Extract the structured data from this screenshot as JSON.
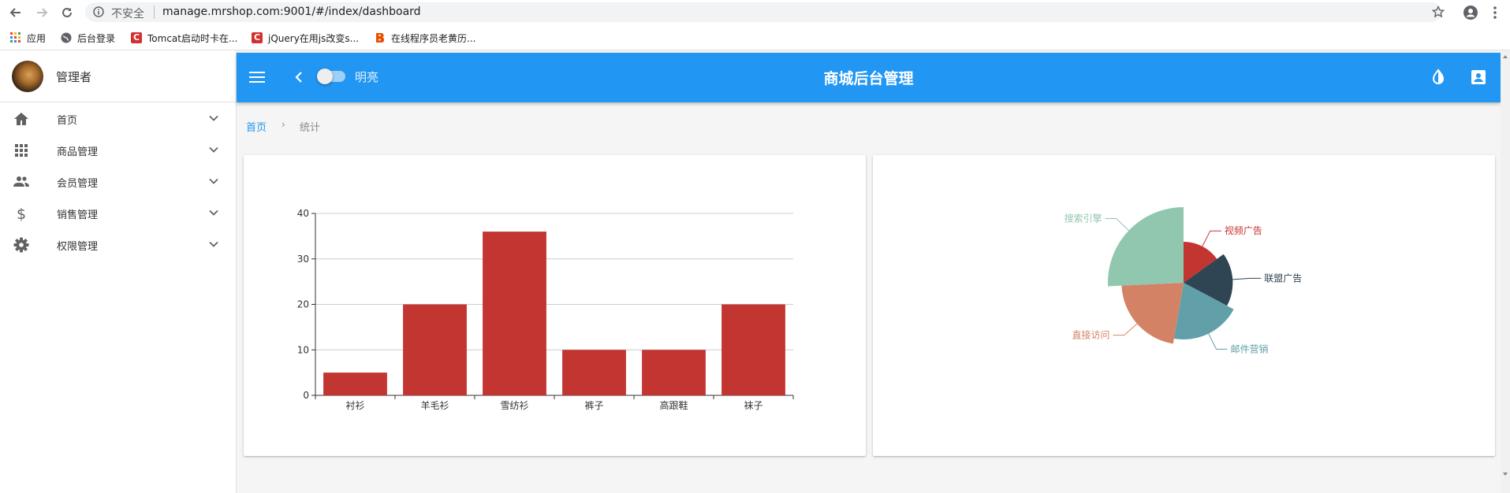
{
  "browser": {
    "insecure_label": "不安全",
    "url": "manage.mrshop.com:9001/#/index/dashboard",
    "bookmarks": [
      {
        "label": "应用",
        "icon": "apps-grid-icon"
      },
      {
        "label": "后台登录",
        "icon": "globe-icon"
      },
      {
        "label": "Tomcat启动时卡在...",
        "icon": "c-logo-icon"
      },
      {
        "label": "jQuery在用js改变s...",
        "icon": "c-logo-icon"
      },
      {
        "label": "在线程序员老黄历...",
        "icon": "b-logo-icon"
      }
    ]
  },
  "sidebar": {
    "user_name": "管理者",
    "items": [
      {
        "label": "首页",
        "icon": "home-icon"
      },
      {
        "label": "商品管理",
        "icon": "apps-icon"
      },
      {
        "label": "会员管理",
        "icon": "people-icon"
      },
      {
        "label": "销售管理",
        "icon": "dollar-icon"
      },
      {
        "label": "权限管理",
        "icon": "settings-icon"
      }
    ]
  },
  "appbar": {
    "title": "商城后台管理",
    "theme_label": "明亮",
    "theme_toggle_on": false
  },
  "breadcrumb": {
    "home": "首页",
    "separator": "›",
    "current": "统计"
  },
  "colors": {
    "primary": "#2196f3",
    "bar": "#c23531"
  },
  "chart_data": [
    {
      "type": "bar",
      "categories": [
        "衬衫",
        "羊毛衫",
        "雪纺衫",
        "裤子",
        "高跟鞋",
        "袜子"
      ],
      "values": [
        5,
        20,
        36,
        10,
        10,
        20
      ],
      "ylim": [
        0,
        40
      ],
      "yticks": [
        0,
        10,
        20,
        30,
        40
      ],
      "grid": true,
      "color": "#c23531"
    },
    {
      "type": "pie",
      "rose": true,
      "slices": [
        {
          "name": "视频广告",
          "value": 235,
          "color": "#c23531"
        },
        {
          "name": "联盟广告",
          "value": 274,
          "color": "#2f4554"
        },
        {
          "name": "邮件营销",
          "value": 310,
          "color": "#61a0a8"
        },
        {
          "name": "直接访问",
          "value": 335,
          "color": "#d48265"
        },
        {
          "name": "搜索引擎",
          "value": 400,
          "color": "#91c7ae"
        }
      ]
    }
  ]
}
